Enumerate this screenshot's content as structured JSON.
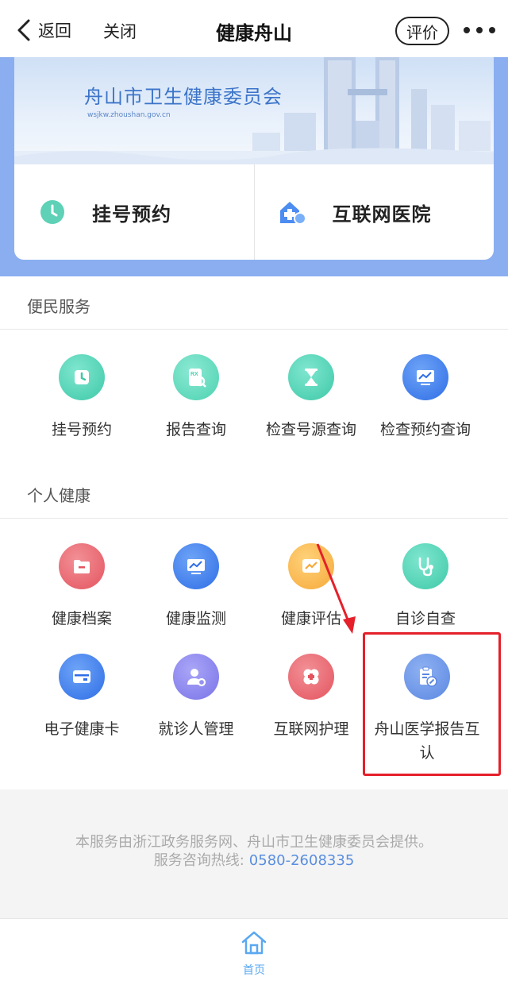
{
  "nav": {
    "back_label": "返回",
    "close_label": "关闭",
    "title": "健康舟山",
    "rate_label": "评价",
    "more_icon": "more-dots-icon"
  },
  "banner": {
    "org_name": "舟山市卫生健康委员会",
    "url": "wsjkw.zhoushan.gov.cn"
  },
  "quick_actions": [
    {
      "label": "挂号预约",
      "icon": "clock-icon"
    },
    {
      "label": "互联网医院",
      "icon": "hospital-plus-icon"
    }
  ],
  "sections": {
    "convenience": {
      "title": "便民服务",
      "items": [
        {
          "label": "挂号预约",
          "icon": "clock-icon",
          "color": "#3fc9a8"
        },
        {
          "label": "报告查询",
          "icon": "rx-report-icon",
          "color": "#4dd2b0"
        },
        {
          "label": "检查号源查询",
          "icon": "hourglass-icon",
          "color": "#3fc9a8"
        },
        {
          "label": "检查预约查询",
          "icon": "monitor-chart-icon",
          "color": "#2f6ee6"
        }
      ]
    },
    "personal": {
      "title": "个人健康",
      "items": [
        {
          "label": "健康档案",
          "icon": "folder-icon",
          "color": "#e4545f"
        },
        {
          "label": "健康监测",
          "icon": "monitor-chart-icon",
          "color": "#2f6ee6"
        },
        {
          "label": "健康评估",
          "icon": "assessment-icon",
          "color": "#f6a93a"
        },
        {
          "label": "自诊自查",
          "icon": "stethoscope-icon",
          "color": "#3fc9a8"
        },
        {
          "label": "电子健康卡",
          "icon": "card-icon",
          "color": "#2f6ee6"
        },
        {
          "label": "就诊人管理",
          "icon": "user-settings-icon",
          "color": "#7a73e8"
        },
        {
          "label": "互联网护理",
          "icon": "nursing-cross-icon",
          "color": "#e4545f"
        },
        {
          "label": "舟山医学报告互认",
          "icon": "report-edit-icon",
          "color": "#5b88e2"
        }
      ]
    }
  },
  "footer": {
    "line1": "本服务由浙江政务服务网、舟山市卫生健康委员会提供。",
    "line2_prefix": "服务咨询热线:",
    "hotline": "0580-2608335"
  },
  "tabbar": {
    "home_label": "首页"
  },
  "annotation": {
    "color": "#e5202b"
  }
}
